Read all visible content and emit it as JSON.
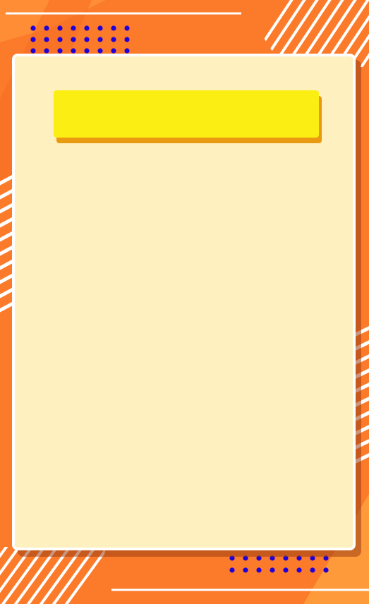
{
  "colors": {
    "background": "#fb7b2a",
    "background_light": "#ff8d35",
    "card": "#fff0bf",
    "card_border": "#ffffff",
    "banner": "#fbee12",
    "banner_shadow": "#e99a10",
    "dots": "#2100d8",
    "stripes": "#ffffff"
  },
  "decorations": {
    "dot_grid_top": "dot-grid",
    "dot_grid_bottom": "dot-grid",
    "stripes": "diagonal-stripes"
  },
  "card": {
    "banner_text": ""
  }
}
